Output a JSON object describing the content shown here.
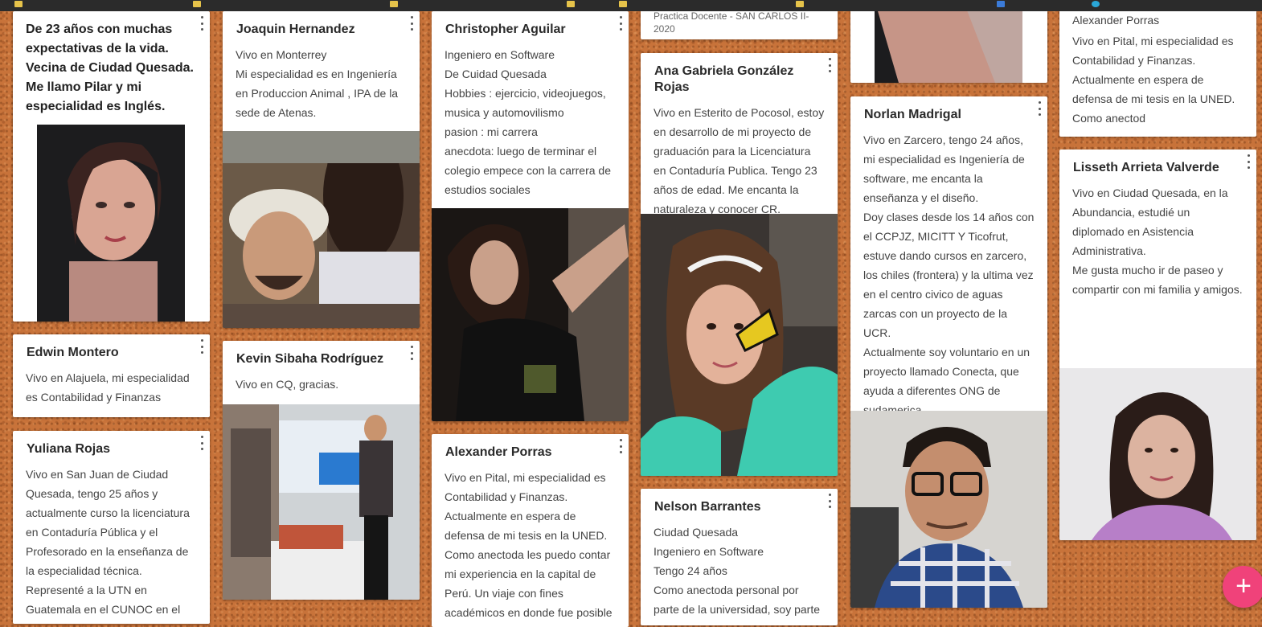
{
  "fab": {
    "label": "+"
  },
  "cards": {
    "pilar": {
      "body": "De 23 años con muchas expectativas de la vida. Vecina de Ciudad Quesada. Me llamo Pilar y mi especialidad es Inglés."
    },
    "edwin": {
      "title": "Edwin Montero",
      "body": "Vivo en Alajuela, mi especialidad es Contabilidad y Finanzas"
    },
    "yuliana": {
      "title": "Yuliana Rojas",
      "body": "Vivo en San Juan de Ciudad Quesada, tengo 25 años y actualmente curso la licenciatura en Contaduría Pública y el Profesorado en la enseñanza de la especialidad técnica.\nRepresenté a la UTN en Guatemala en el CUNOC en el año"
    },
    "joaquin": {
      "title": "Joaquin Hernandez",
      "body": "Vivo en Monterrey\nMi especialidad es en Ingeniería en  Produccion Animal , IPA de la sede de Atenas."
    },
    "kevin": {
      "title": "Kevin Sibaha Rodríguez",
      "body": "Vivo en CQ, gracias."
    },
    "christopher": {
      "title": "Christopher Aguilar",
      "body": "Ingeniero en Software\nDe Cuidad Quesada\nHobbies : ejercicio, videojuegos, musica y automovilismo\npasion : mi carrera\nanecdota: luego de terminar el colegio empece con la carrera de estudios sociales"
    },
    "alexander": {
      "title": "Alexander Porras",
      "body": "Vivo en Pital, mi especialidad es Contabilidad y Finanzas.\nActualmente en espera de defensa de mi tesis en la UNED.\nComo anectoda les puedo contar mi experiencia en la capital de Perú. Un viaje con fines académicos en donde fue posible"
    },
    "practica": {
      "meta": "Practica Docente - SAN CARLOS II-2020",
      "source": "padlet"
    },
    "ana": {
      "title": "Ana Gabriela González Rojas",
      "body": "Vivo en Esterito de Pocosol, estoy en desarrollo de mi proyecto de graduación para la Licenciatura en Contaduría Publica. Tengo 23 años de edad. Me encanta la naturaleza y conocer CR."
    },
    "nelson": {
      "title": "Nelson Barrantes",
      "body": "  Ciudad Quesada\nIngeniero en Software\nTengo 24 años\nComo anectoda personal por parte de la universidad, soy parte"
    },
    "norlan": {
      "title": "Norlan Madrigal",
      "body": "Vivo en Zarcero, tengo 24 años, mi especialidad es Ingeniería de software, me encanta la enseñanza y el diseño.\nDoy clases desde los 14 años con el CCPJZ, MICITT Y Ticofrut, estuve  dando cursos en zarcero, los chiles (frontera) y la ultima vez en el centro civico de aguas zarcas con un proyecto de la UCR.\nActualmente soy voluntario en un proyecto llamado Conecta, que ayuda a diferentes ONG de sudamerica."
    },
    "alexander2": {
      "title": "Alexander Porras",
      "body": "Vivo en Pital, mi especialidad es Contabilidad y Finanzas.\nActualmente en espera de defensa de mi tesis en la UNED.\nComo anectod"
    },
    "lisseth": {
      "title": "Lisseth Arrieta Valverde",
      "body": "Vivo en Ciudad Quesada, en la Abundancia,  estudié un diplomado en Asistencia Administrativa.\nMe gusta mucho ir de paseo y compartir con mi familia y amigos."
    }
  },
  "colors": {
    "board": "#c8733a",
    "fab": "#f0427a",
    "card": "#ffffff"
  },
  "icons": {
    "kebab": "more-vert-icon",
    "fab": "plus-icon"
  }
}
